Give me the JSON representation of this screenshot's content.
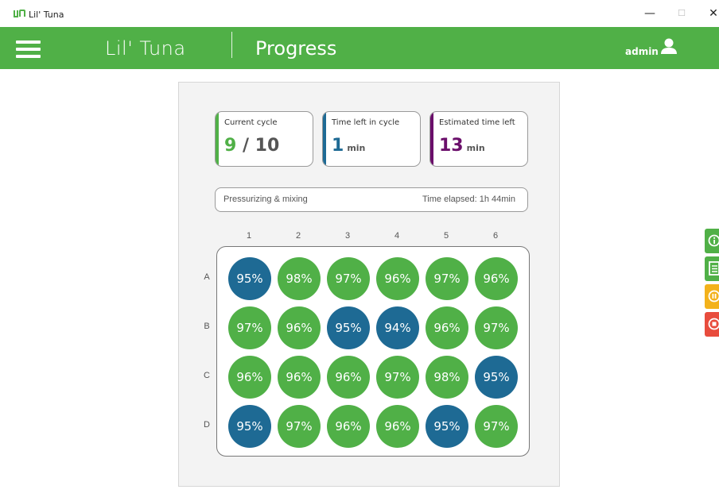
{
  "window": {
    "title": "Lil' Tuna",
    "minimize_glyph": "—",
    "maximize_glyph": "☐",
    "close_glyph": "✕"
  },
  "header": {
    "brand": "Lil' Tuna",
    "page_title": "Progress",
    "username": "admin",
    "accent_color": "#50b047"
  },
  "stats": [
    {
      "label": "Current cycle",
      "value": "9",
      "separator": " / ",
      "total": "10",
      "unit": "",
      "color": "#50b047"
    },
    {
      "label": "Time left in cycle",
      "value": "1",
      "unit": "min",
      "color": "#1e6a94"
    },
    {
      "label": "Estimated time left",
      "value": "13",
      "unit": "min",
      "color": "#6b0f6b"
    }
  ],
  "status": {
    "phase": "Pressurizing & mixing",
    "elapsed": "Time elapsed: 1h 44min"
  },
  "plate": {
    "columns": [
      "1",
      "2",
      "3",
      "4",
      "5",
      "6"
    ],
    "rows": [
      "A",
      "B",
      "C",
      "D"
    ],
    "colors": {
      "ok": "#50b047",
      "low": "#1e6a94"
    },
    "wells": [
      [
        {
          "value": "95%",
          "state": "low"
        },
        {
          "value": "98%",
          "state": "ok"
        },
        {
          "value": "97%",
          "state": "ok"
        },
        {
          "value": "96%",
          "state": "ok"
        },
        {
          "value": "97%",
          "state": "ok"
        },
        {
          "value": "96%",
          "state": "ok"
        }
      ],
      [
        {
          "value": "97%",
          "state": "ok"
        },
        {
          "value": "96%",
          "state": "ok"
        },
        {
          "value": "95%",
          "state": "low"
        },
        {
          "value": "94%",
          "state": "low"
        },
        {
          "value": "96%",
          "state": "ok"
        },
        {
          "value": "97%",
          "state": "ok"
        }
      ],
      [
        {
          "value": "96%",
          "state": "ok"
        },
        {
          "value": "96%",
          "state": "ok"
        },
        {
          "value": "96%",
          "state": "ok"
        },
        {
          "value": "97%",
          "state": "ok"
        },
        {
          "value": "98%",
          "state": "ok"
        },
        {
          "value": "95%",
          "state": "low"
        }
      ],
      [
        {
          "value": "95%",
          "state": "low"
        },
        {
          "value": "97%",
          "state": "ok"
        },
        {
          "value": "96%",
          "state": "ok"
        },
        {
          "value": "96%",
          "state": "ok"
        },
        {
          "value": "95%",
          "state": "low"
        },
        {
          "value": "97%",
          "state": "ok"
        }
      ]
    ]
  },
  "side_actions": [
    {
      "name": "info",
      "icon": "info-icon",
      "color": "#50b047"
    },
    {
      "name": "log",
      "icon": "document-icon",
      "color": "#50b047"
    },
    {
      "name": "pause",
      "icon": "pause-icon",
      "color": "#f3b21b"
    },
    {
      "name": "stop",
      "icon": "stop-icon",
      "color": "#e84c3d"
    }
  ]
}
